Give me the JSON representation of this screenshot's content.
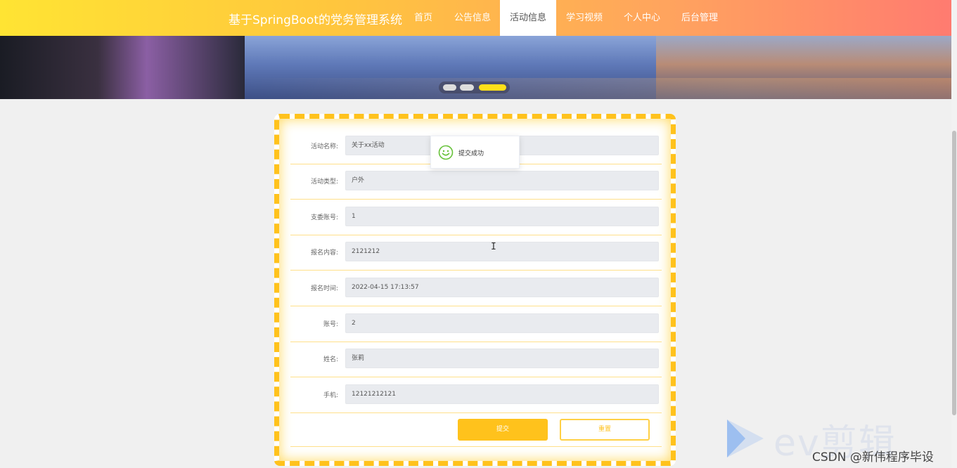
{
  "nav": {
    "title": "基于SpringBoot的党务管理系统",
    "items": [
      {
        "label": "首页",
        "active": false
      },
      {
        "label": "公告信息",
        "active": false
      },
      {
        "label": "活动信息",
        "active": true
      },
      {
        "label": "学习视频",
        "active": false
      },
      {
        "label": "个人中心",
        "active": false
      },
      {
        "label": "后台管理",
        "active": false
      }
    ]
  },
  "banner": {
    "slides_count": 3,
    "active_slide": 3
  },
  "form": {
    "fields": [
      {
        "label": "活动名称:",
        "value": "关于xx活动"
      },
      {
        "label": "活动类型:",
        "value": "户外"
      },
      {
        "label": "支委账号:",
        "value": "1"
      },
      {
        "label": "报名内容:",
        "value": "2121212"
      },
      {
        "label": "报名时间:",
        "value": "2022-04-15 17:13:57"
      },
      {
        "label": "账号:",
        "value": "2"
      },
      {
        "label": "姓名:",
        "value": "张莉"
      },
      {
        "label": "手机:",
        "value": "12121212121"
      }
    ],
    "submit_label": "提交",
    "reset_label": "重置"
  },
  "toast": {
    "icon": "smile-icon",
    "message": "提交成功",
    "color": "#67c23a"
  },
  "watermark": {
    "logo": "ev-play-logo",
    "brand": "ev剪辑",
    "csdn": "CSDN @新伟程序毕设"
  },
  "colors": {
    "accent": "#ffc21c",
    "nav_gradient_start": "#ffe433",
    "nav_gradient_end": "#ff7b70"
  }
}
